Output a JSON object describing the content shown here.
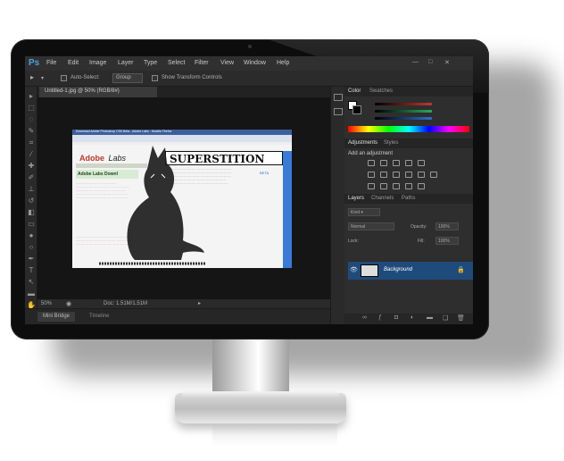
{
  "window": {
    "app_icon": "Ps",
    "menu": [
      "File",
      "Edit",
      "Image",
      "Layer",
      "Type",
      "Select",
      "Filter",
      "View",
      "Window",
      "Help"
    ]
  },
  "options_bar": {
    "auto_select_label": "Auto-Select:",
    "auto_select_value": "Group",
    "show_transform_label": "Show Transform Controls"
  },
  "document": {
    "tab_label": "Untitled-1.jpg @ 50% (RGB/8#)",
    "content": {
      "browser_title": "Download Adobe Photoshop CS6 Beta - Adobe Labs - Mozilla Firefox",
      "heading": "Adobe",
      "heading_italic": "Labs",
      "section_title": "Adobe Labs Downl",
      "banner": "SUPERSTITION",
      "badge": "BETA"
    },
    "zoom": "50%",
    "doc_size": "Doc: 1.51M/1.51M"
  },
  "bottom_tabs": [
    "Mini Bridge",
    "Timeline"
  ],
  "panels": {
    "color_tabs": [
      "Color",
      "Swatches"
    ],
    "adjust_tabs": [
      "Adjustments",
      "Styles"
    ],
    "adjust_title": "Add an adjustment",
    "layers_tabs": [
      "Layers",
      "Channels",
      "Paths"
    ],
    "kind_label": "Kind",
    "blend_mode": "Normal",
    "opacity_label": "Opacity:",
    "opacity_value": "100%",
    "lock_label": "Lock:",
    "fill_label": "Fill:",
    "fill_value": "100%",
    "layer_name": "Background"
  },
  "colors": {
    "ps_blue": "#4aa3e0",
    "selected_layer": "#1f4b7c",
    "red_slider": "#c0392b",
    "green_slider": "#27ae60",
    "blue_slider": "#2e6fd1"
  }
}
